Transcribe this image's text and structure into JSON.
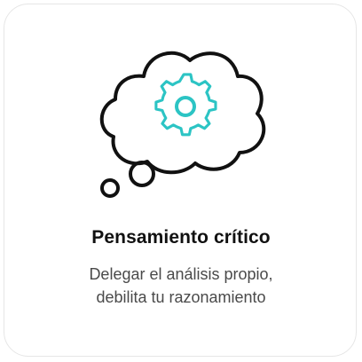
{
  "card": {
    "title": "Pensamiento crítico",
    "description_lines": [
      "Delegar el análisis propio,",
      "debilita tu razonamiento"
    ]
  },
  "icons": {
    "main": "thought-cloud-icon",
    "inner": "gear-icon"
  },
  "colors": {
    "outline": "#111111",
    "accent": "#2cc4c4",
    "border": "#e6e6e6",
    "title": "#111111",
    "text": "#4a4a4a"
  }
}
